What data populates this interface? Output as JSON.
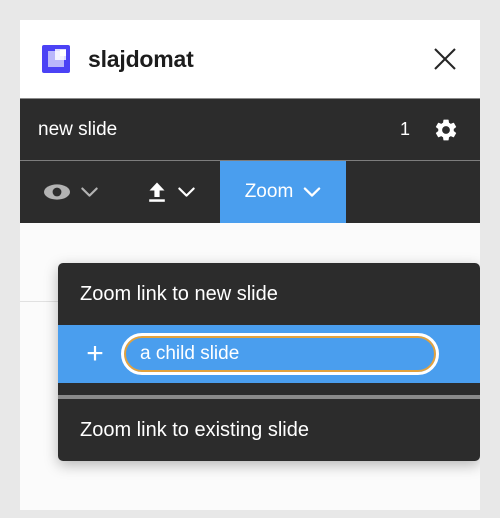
{
  "window": {
    "title": "slajdomat",
    "logo_icon": "slajdomat-logo-icon",
    "close_icon": "close-icon"
  },
  "slide_bar": {
    "slide_name": "new slide",
    "slide_count": "1",
    "settings_icon": "gear-icon"
  },
  "toolbar": {
    "items": [
      {
        "name": "visibility",
        "icon": "eye-icon",
        "label": "",
        "chevron": "chevron-down-icon",
        "active": false
      },
      {
        "name": "upload",
        "icon": "upload-icon",
        "label": "",
        "chevron": "chevron-down-icon",
        "active": false
      },
      {
        "name": "zoom",
        "icon": "",
        "label": "Zoom",
        "chevron": "chevron-down-icon",
        "active": true
      }
    ],
    "zoom_label": "Zoom"
  },
  "zoom_menu": {
    "item_new_slide": "Zoom link to new slide",
    "add_icon": "plus-icon",
    "child_slide_value": "a child slide",
    "child_slide_placeholder": "a child slide",
    "item_existing_slide": "Zoom link to existing slide"
  },
  "colors": {
    "accent_blue": "#4a9eee",
    "dark_chrome": "#2c2c2c",
    "logo_indigo": "#4b42f5",
    "input_focus_amber": "#e3a23c",
    "page_background": "#e8e8e8"
  }
}
